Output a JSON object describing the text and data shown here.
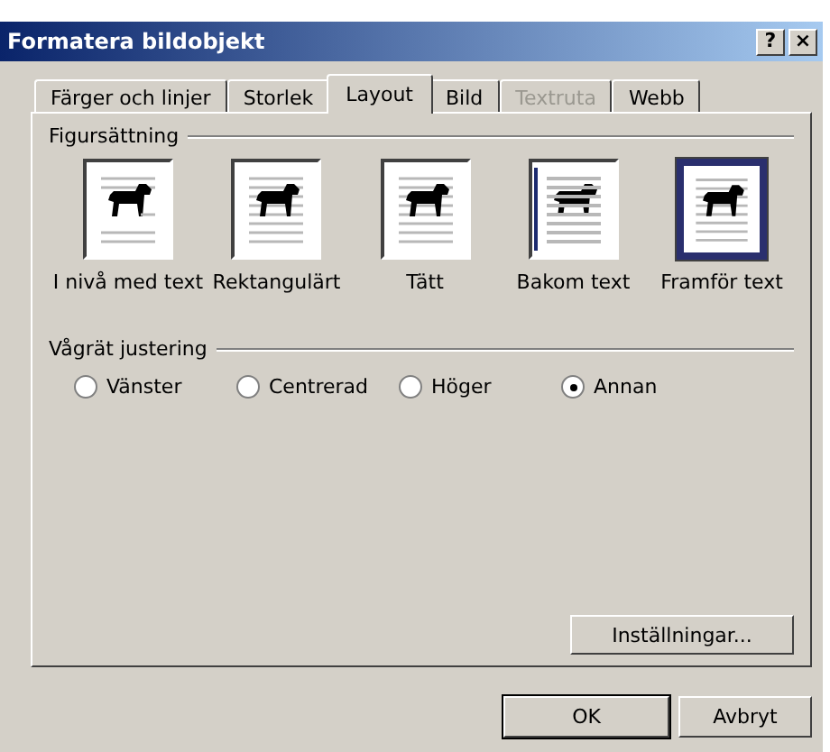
{
  "window": {
    "title": "Formatera bildobjekt"
  },
  "title_buttons": [
    "?",
    "×"
  ],
  "tabs": [
    {
      "label": "Färger och linjer",
      "selected": false,
      "disabled": false
    },
    {
      "label": "Storlek",
      "selected": false,
      "disabled": false
    },
    {
      "label": "Layout",
      "selected": true,
      "disabled": false
    },
    {
      "label": "Bild",
      "selected": false,
      "disabled": false
    },
    {
      "label": "Textruta",
      "selected": false,
      "disabled": true
    },
    {
      "label": "Webb",
      "selected": false,
      "disabled": false
    }
  ],
  "wrapping": {
    "title": "Figursättning",
    "options": [
      {
        "kind": "inline",
        "label": "I nivå med text",
        "selected": false
      },
      {
        "kind": "square",
        "label": "Rektangulärt",
        "selected": false
      },
      {
        "kind": "tight",
        "label": "Tätt",
        "selected": false
      },
      {
        "kind": "behind",
        "label": "Bakom text",
        "selected": false
      },
      {
        "kind": "front",
        "label": "Framför text",
        "selected": true
      }
    ]
  },
  "alignment": {
    "title": "Vågrät justering",
    "options": [
      {
        "label": "Vänster",
        "selected": false
      },
      {
        "label": "Centrerad",
        "selected": false
      },
      {
        "label": "Höger",
        "selected": false
      },
      {
        "label": "Annan",
        "selected": true
      }
    ]
  },
  "settings_button": "Inställningar...",
  "buttons": [
    "OK",
    "Avbryt"
  ]
}
